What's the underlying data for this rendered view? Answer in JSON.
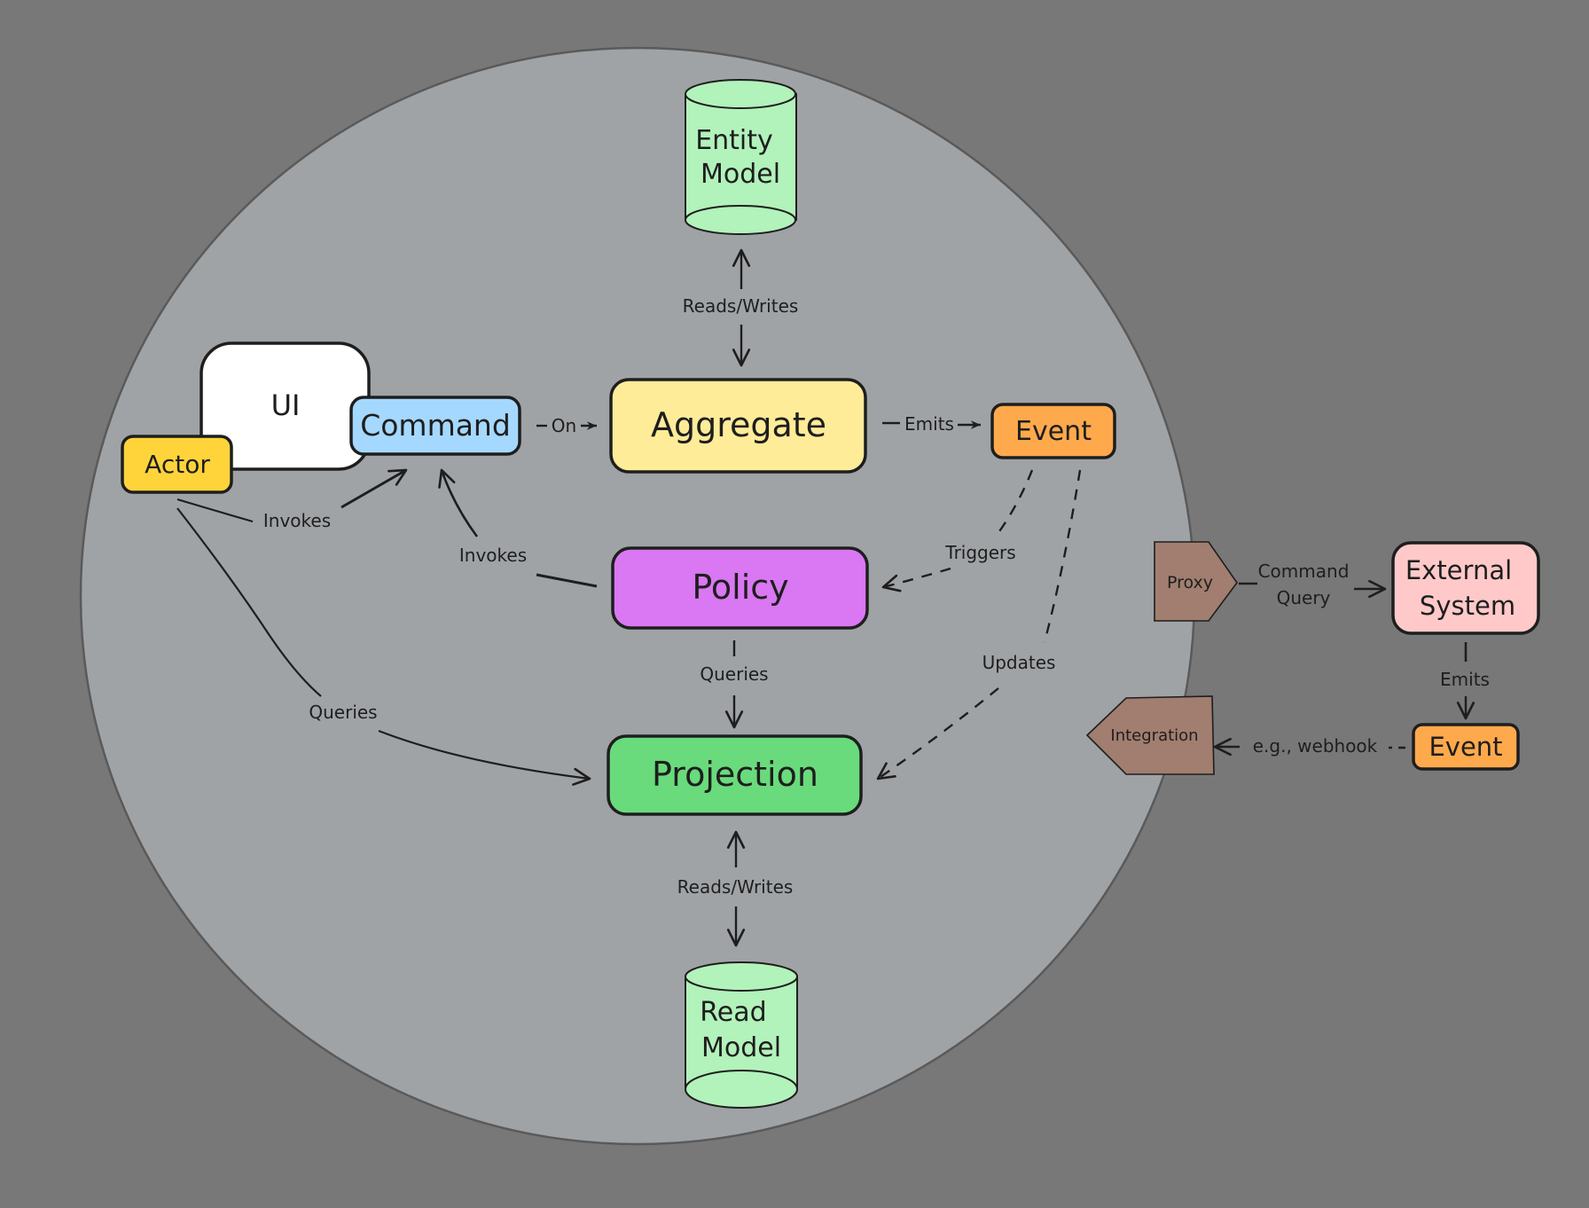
{
  "colors": {
    "background": "#787878",
    "boundary": "#a0a3a6",
    "stroke": "#1e1e1e",
    "actor": "#ffd43b",
    "ui": "#ffffff",
    "command": "#a5d8ff",
    "aggregate": "#ffec99",
    "event": "#ffa94d",
    "policy": "#da77f2",
    "projection": "#69db7c",
    "storage": "#b2f2bb",
    "proxy": "#a17e6f",
    "external": "#ffc9c9"
  },
  "nodes": {
    "entity_model": {
      "lines": [
        "Entity",
        "Model"
      ]
    },
    "ui": {
      "label": "UI"
    },
    "command": {
      "label": "Command"
    },
    "actor": {
      "label": "Actor"
    },
    "aggregate": {
      "label": "Aggregate"
    },
    "event": {
      "label": "Event"
    },
    "policy": {
      "label": "Policy"
    },
    "projection": {
      "label": "Projection"
    },
    "read_model": {
      "lines": [
        "Read",
        "Model"
      ]
    },
    "proxy": {
      "label": "Proxy"
    },
    "external_system": {
      "lines": [
        "External",
        "System"
      ]
    },
    "external_event": {
      "label": "Event"
    },
    "integration": {
      "label": "Integration"
    }
  },
  "edges": {
    "aggregate_entity": {
      "label": "Reads/Writes"
    },
    "command_aggregate": {
      "label": "On"
    },
    "aggregate_event": {
      "label": "Emits"
    },
    "actor_command": {
      "label": "Invokes"
    },
    "policy_command": {
      "label": "Invokes"
    },
    "event_policy": {
      "label": "Triggers"
    },
    "event_projection": {
      "label": "Updates"
    },
    "policy_projection": {
      "label": "Queries"
    },
    "actor_projection": {
      "label": "Queries"
    },
    "projection_readmodel": {
      "label": "Reads/Writes"
    },
    "proxy_external": {
      "lines": [
        "Command",
        "Query"
      ]
    },
    "external_event": {
      "label": "Emits"
    },
    "event_integration": {
      "label": "e.g., webhook"
    }
  }
}
